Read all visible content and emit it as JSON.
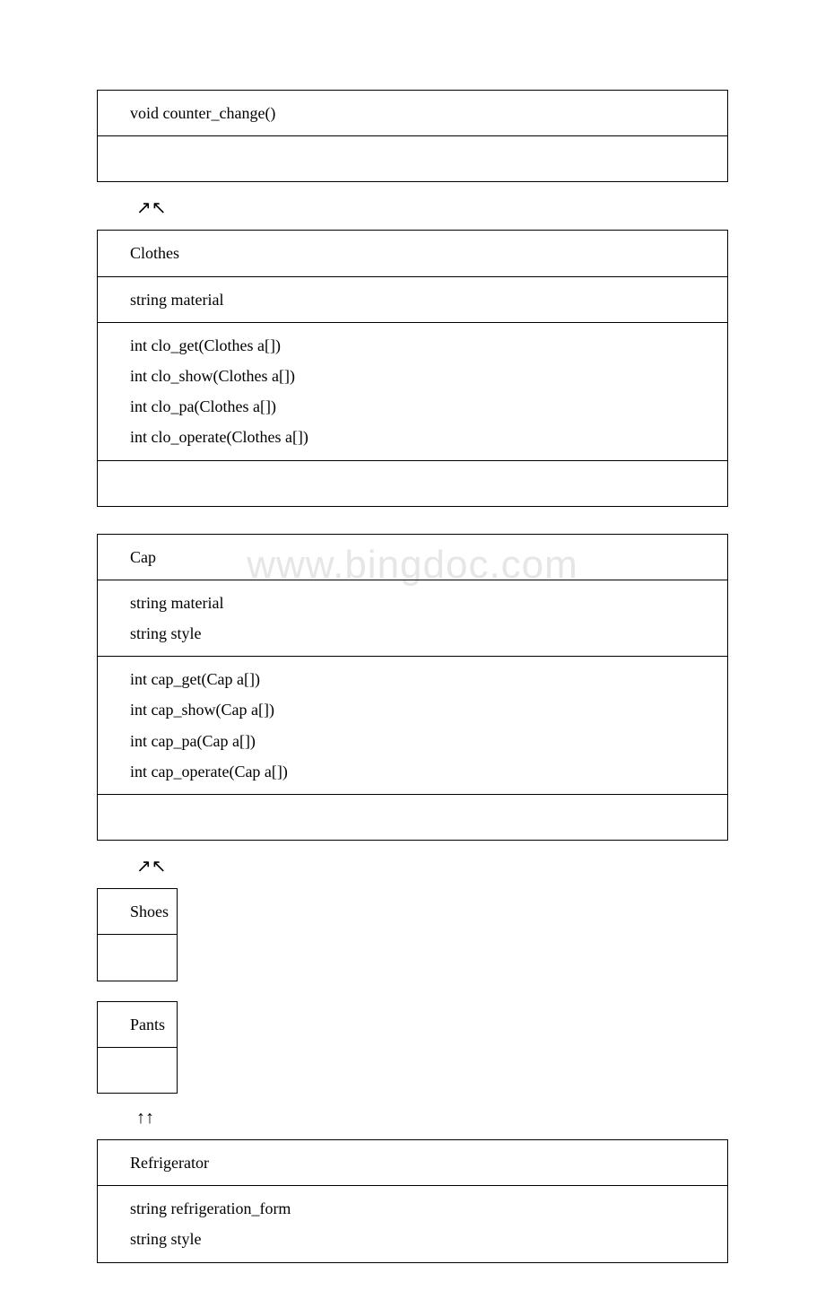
{
  "watermark": "www.bingdoc.com",
  "arrows": {
    "upDiagonal": "↗↖",
    "upStraight": "↑↑"
  },
  "classes": {
    "counter": {
      "methods": [
        "void counter_change()"
      ]
    },
    "clothes": {
      "name": "Clothes",
      "attributes": [
        "string material"
      ],
      "methods": [
        "int clo_get(Clothes a[])",
        "int clo_show(Clothes a[])",
        "int clo_pa(Clothes a[])",
        "int clo_operate(Clothes a[])"
      ]
    },
    "cap": {
      "name": "Cap",
      "attributes": [
        "string material",
        "string style"
      ],
      "methods": [
        "int cap_get(Cap a[])",
        "int cap_show(Cap a[])",
        "int cap_pa(Cap a[])",
        "int cap_operate(Cap a[])"
      ]
    },
    "shoes": {
      "name": "Shoes"
    },
    "pants": {
      "name": "Pants"
    },
    "refrigerator": {
      "name": "Refrigerator",
      "attributes": [
        "string refrigeration_form",
        "string style"
      ]
    }
  }
}
